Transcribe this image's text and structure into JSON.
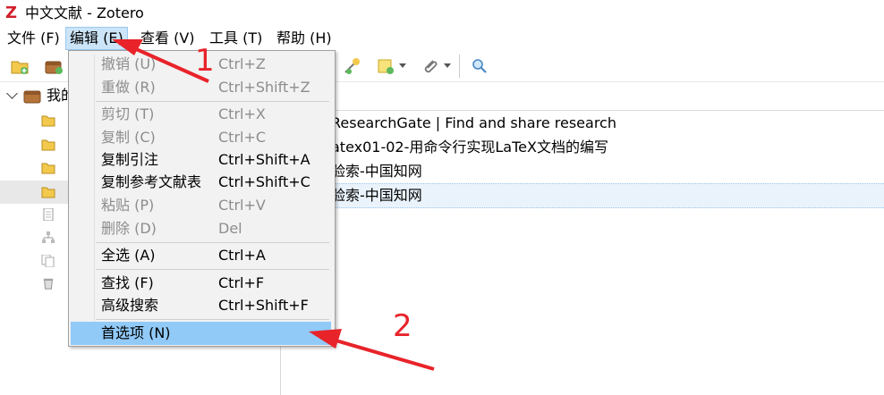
{
  "window": {
    "title": "中文文献 - Zotero"
  },
  "menubar": {
    "items": [
      {
        "label": "文件 (F)"
      },
      {
        "label": "编辑 (E)"
      },
      {
        "label": "查看 (V)"
      },
      {
        "label": "工具 (T)"
      },
      {
        "label": "帮助 (H)"
      }
    ]
  },
  "sidebar": {
    "library_label": "我的"
  },
  "items": {
    "rows": [
      {
        "title": "ResearchGate | Find and share research"
      },
      {
        "title": "atex01-02-用命令行实现LaTeX文档的编写"
      },
      {
        "title": "验索-中国知网"
      },
      {
        "title": "验索-中国知网"
      }
    ]
  },
  "edit_menu": {
    "entries": [
      {
        "label": "撤销 (U)",
        "shortcut": "Ctrl+Z",
        "enabled": false
      },
      {
        "label": "重做 (R)",
        "shortcut": "Ctrl+Shift+Z",
        "enabled": false
      },
      {
        "label": "剪切 (T)",
        "shortcut": "Ctrl+X",
        "enabled": false
      },
      {
        "label": "复制 (C)",
        "shortcut": "Ctrl+C",
        "enabled": false
      },
      {
        "label": "复制引注",
        "shortcut": "Ctrl+Shift+A",
        "enabled": true
      },
      {
        "label": "复制参考文献表",
        "shortcut": "Ctrl+Shift+C",
        "enabled": true
      },
      {
        "label": "粘贴 (P)",
        "shortcut": "Ctrl+V",
        "enabled": false
      },
      {
        "label": "删除 (D)",
        "shortcut": "Del",
        "enabled": false
      },
      {
        "label": "全选 (A)",
        "shortcut": "Ctrl+A",
        "enabled": true
      },
      {
        "label": "查找 (F)",
        "shortcut": "Ctrl+F",
        "enabled": true
      },
      {
        "label": "高级搜索",
        "shortcut": "Ctrl+Shift+F",
        "enabled": true
      },
      {
        "label": "首选项 (N)",
        "shortcut": "",
        "enabled": true,
        "highlighted": true
      }
    ]
  },
  "annotations": {
    "step1": "1",
    "step2": "2",
    "color": "#e8232a"
  },
  "colors": {
    "menu_highlight": "#91c9f7",
    "active_menu": "#cce4f7",
    "brand": "#d0202a"
  }
}
